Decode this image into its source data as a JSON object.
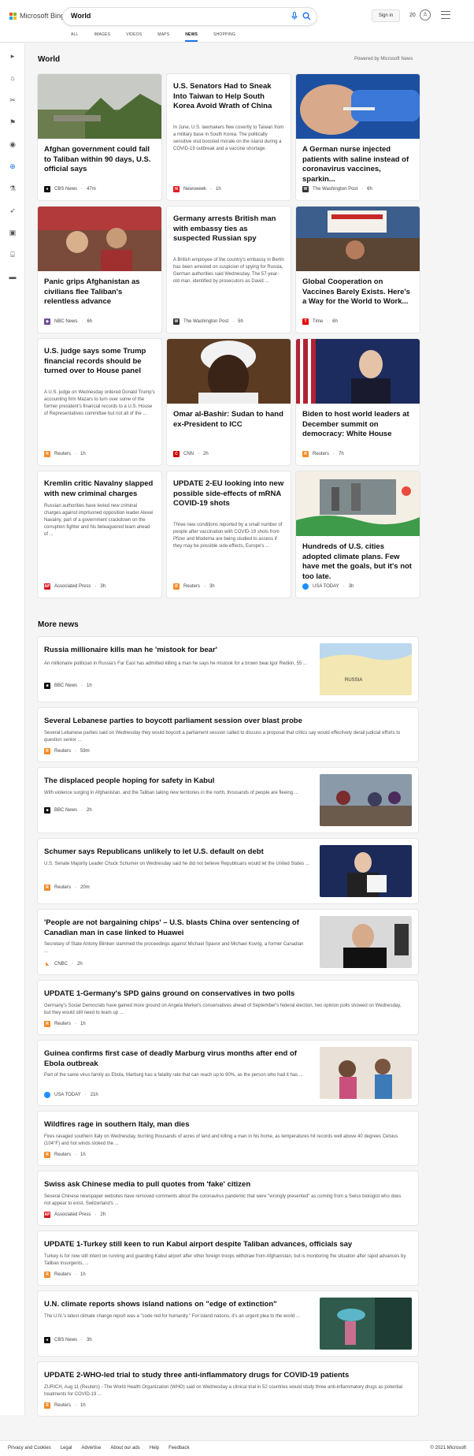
{
  "header": {
    "brand": "Microsoft Bing",
    "query": "World",
    "signin_label": "Sign in",
    "rewards_count": "20",
    "tabs": [
      "ALL",
      "IMAGES",
      "VIDEOS",
      "MAPS",
      "NEWS",
      "SHOPPING"
    ],
    "active_tab": "NEWS"
  },
  "section": {
    "title": "World",
    "powered_by": "Powered by Microsoft News"
  },
  "cards": [
    {
      "title": "Afghan government could fall to Taliban within 90 days, U.S. official says",
      "summary": "",
      "source": "CBS News",
      "time": "47m"
    },
    {
      "title": "U.S. Senators Had to Sneak Into Taiwan to Help South Korea Avoid Wrath of China",
      "summary": "In June, U.S. lawmakers flew covertly to Taiwan from a military base in South Korea. The politically sensitive visit boosted morale on the island during a COVID-19 outbreak and a vaccine shortage.",
      "source": "Newsweek",
      "time": "1h"
    },
    {
      "title": "A German nurse injected patients with saline instead of coronavirus vaccines, sparkin...",
      "summary": "",
      "source": "The Washington Post",
      "time": "6h"
    },
    {
      "title": "Panic grips Afghanistan as civilians flee Taliban's relentless advance",
      "summary": "",
      "source": "NBC News",
      "time": "6h"
    },
    {
      "title": "Germany arrests British man with embassy ties as suspected Russian spy",
      "summary": "A British employee of the country's embassy in Berlin has been arrested on suspicion of spying for Russia, German authorities said Wednesday. The 57-year-old man, identified by prosecutors as David ...",
      "source": "The Washington Post",
      "time": "5h"
    },
    {
      "title": "Global Cooperation on Vaccines Barely Exists. Here's a Way for the World to Work...",
      "summary": "",
      "source": "Time",
      "time": "6h"
    },
    {
      "title": "U.S. judge says some Trump financial records should be turned over to House panel",
      "summary": "A U.S. judge on Wednesday ordered Donald Trump's accounting firm Mazars to turn over some of the former president's financial records to a U.S. House of Representatives committee but not all of the ...",
      "source": "Reuters",
      "time": "1h"
    },
    {
      "title": "Omar al-Bashir: Sudan to hand ex-President to ICC",
      "summary": "",
      "source": "CNN",
      "time": "2h"
    },
    {
      "title": "Biden to host world leaders at December summit on democracy: White House",
      "summary": "",
      "source": "Reuters",
      "time": "7h"
    },
    {
      "title": "Kremlin critic Navalny slapped with new criminal charges",
      "summary": "Russian authorities have levied new criminal charges against imprisoned opposition leader Alexei Navalny, part of a government crackdown on the corruption fighter and his beleaguered team ahead of ...",
      "source": "Associated Press",
      "time": "3h"
    },
    {
      "title": "UPDATE 2-EU looking into new possible side-effects of mRNA COVID-19 shots",
      "summary": "Three new conditions reported by a small number of people after vaccination with COVID-19 shots from Pfizer and Moderna are being studied to assess if they may be possible side-effects, Europe's ...",
      "source": "Reuters",
      "time": "3h"
    },
    {
      "title": "Hundreds of U.S. cities adopted climate plans. Few have met the goals, but it's not too late.",
      "summary": "",
      "source": "USA TODAY",
      "time": "3h"
    }
  ],
  "more_news": {
    "title": "More news",
    "items": [
      {
        "title": "Russia millionaire kills man he 'mistook for bear'",
        "summary": "An millionaire politician in Russia's Far East has admitted killing a man he says he mistook for a brown bear.Igor Redkin, 55 ...",
        "source": "BBC News",
        "time": "1h",
        "thumb_label": "RUSSIA"
      },
      {
        "title": "Several Lebanese parties to boycott parliament session over blast probe",
        "summary": "Several Lebanese parties said on Wednesday they would boycott a parliament session called to discuss a proposal that critics say would effectively derail judicial efforts to question senior ...",
        "source": "Reuters",
        "time": "59m"
      },
      {
        "title": "The displaced people hoping for safety in Kabul",
        "summary": "With violence surging in Afghanistan, and the Taliban taking new territories in the north, thousands of people are fleeing ...",
        "source": "BBC News",
        "time": "2h"
      },
      {
        "title": "Schumer says Republicans unlikely to let U.S. default on debt",
        "summary": "U.S. Senate Majority Leader Chuck Schumer on Wednesday said he did not believe Republicans would let the United States ...",
        "source": "Reuters",
        "time": "20m"
      },
      {
        "title": "'People are not bargaining chips' – U.S. blasts China over sentencing of Canadian man in case linked to Huawei",
        "summary": "Secretary of State Antony Blinken slammed the proceedings against Michael Spavor and Michael Kovrig, a former Canadian ...",
        "source": "CNBC",
        "time": "2h"
      },
      {
        "title": "UPDATE 1-Germany's SPD gains ground on conservatives in two polls",
        "summary": "Germany's Social Democrats have gained more ground on Angela Merkel's conservatives ahead of September's federal election, two opinion polls showed on Wednesday, but they would still need to team up ...",
        "source": "Reuters",
        "time": "1h"
      },
      {
        "title": "Guinea confirms first case of deadly Marburg virus months after end of Ebola outbreak",
        "summary": "Part of the same virus family as Ebola, Marburg has a fatality rate that can reach up to 90%, as the person who had it has ...",
        "source": "USA TODAY",
        "time": "21h"
      },
      {
        "title": "Wildfires rage in southern Italy, man dies",
        "summary": "Fires ravaged southern Italy on Wednesday, burning thousands of acres of land and killing a man in his home, as temperatures hit records well above 40 degrees Celsius (104°F) and hot winds stoked the ...",
        "source": "Reuters",
        "time": "1h"
      },
      {
        "title": "Swiss ask Chinese media to pull quotes from 'fake' citizen",
        "summary": "Several Chinese newspaper websites have removed comments about the coronavirus pandemic that were \"wrongly presented\" as coming from a Swiss biologist who does not appear to exist, Switzerland's ...",
        "source": "Associated Press",
        "time": "2h"
      },
      {
        "title": "UPDATE 1-Turkey still keen to run Kabul airport despite Taliban advances, officials say",
        "summary": "Turkey is for now still intent on running and guarding Kabul airport after other foreign troops withdraw from Afghanistan, but is monitoring the situation after rapid advances by Taliban insurgents, ...",
        "source": "Reuters",
        "time": "1h"
      },
      {
        "title": "U.N. climate reports shows island nations on \"edge of extinction\"",
        "summary": "The U.N.'s latest climate change report was a \"code red for humanity.\" For island nations, it's an urgent plea to the world ...",
        "source": "CBS News",
        "time": "3h"
      },
      {
        "title": "UPDATE 2-WHO-led trial to study three anti-inflammatory drugs for COVID-19 patients",
        "summary": "ZURICH, Aug 11 (Reuters) - The World Health Organization (WHO) said on Wednesday a clinical trial in 52 countries would study three anti-inflammatory drugs as potential treatments for COVID-19 ...",
        "source": "Reuters",
        "time": "1h"
      }
    ]
  },
  "footer": {
    "links": [
      "Privacy and Cookies",
      "Legal",
      "Advertise",
      "About our ads",
      "Help",
      "Feedback"
    ],
    "copyright": "© 2021 Microsoft"
  },
  "colors": {
    "accent": "#1a73e8",
    "reuters": "#f28c28",
    "cnn": "#cc0000",
    "newsweek": "#e31b23",
    "time": "#e90606",
    "usatoday": "#1e90ff",
    "ap": "#d71920"
  },
  "icons": [
    "mic-icon",
    "search-icon",
    "rewards-icon",
    "menu-icon",
    "collapse-icon",
    "home-icon",
    "news-icon",
    "flag-icon",
    "location-icon",
    "globe-icon",
    "science-icon",
    "rocket-icon",
    "entertainment-icon",
    "building-icon",
    "money-icon"
  ]
}
